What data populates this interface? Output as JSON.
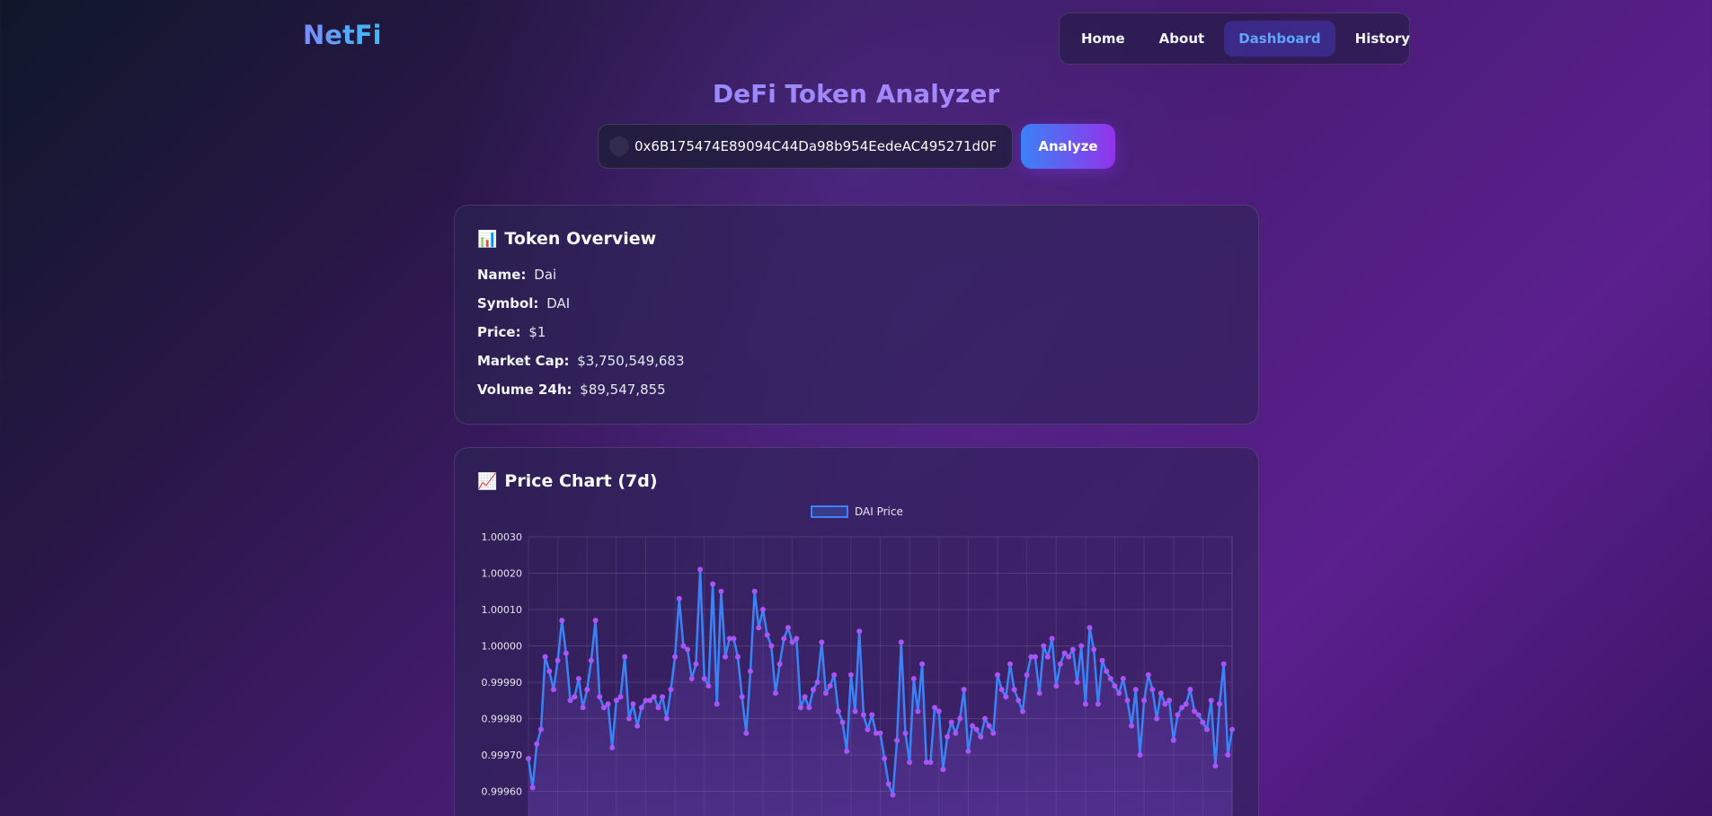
{
  "header": {
    "logo": "NetFi",
    "nav": [
      "Home",
      "About",
      "Dashboard",
      "History"
    ],
    "active_nav": "Dashboard"
  },
  "page_title": "DeFi Token Analyzer",
  "search": {
    "value": "0x6B175474E89094C44Da98b954EedeAC495271d0F",
    "button_label": "Analyze"
  },
  "overview": {
    "title": "Token Overview",
    "icon": "bar-chart-emoji",
    "rows": [
      {
        "label": "Name:",
        "value": "Dai"
      },
      {
        "label": "Symbol:",
        "value": "DAI"
      },
      {
        "label": "Price:",
        "value": "$1"
      },
      {
        "label": "Market Cap:",
        "value": "$3,750,549,683"
      },
      {
        "label": "Volume 24h:",
        "value": "$89,547,855"
      }
    ]
  },
  "chart_card": {
    "title": "Price Chart (7d)",
    "icon": "line-chart-emoji"
  },
  "chart_data": {
    "type": "line",
    "legend": "DAI Price",
    "legend_position": "top",
    "grid": true,
    "ylim": [
      0.99955,
      1.0003
    ],
    "yticks": [
      "1.00030",
      "1.00020",
      "1.00010",
      "1.00000",
      "0.99990",
      "0.99980",
      "0.99970",
      "0.99960"
    ],
    "colors": {
      "line": "#3b82f6",
      "point": "#a855f7"
    },
    "series": [
      {
        "name": "DAI Price",
        "values": [
          0.99969,
          0.99961,
          0.99973,
          0.99977,
          0.99997,
          0.99993,
          0.99988,
          0.99996,
          1.00007,
          0.99998,
          0.99985,
          0.99986,
          0.99991,
          0.99983,
          0.99988,
          0.99996,
          1.00007,
          0.99986,
          0.99983,
          0.99984,
          0.99972,
          0.99985,
          0.99986,
          0.99997,
          0.9998,
          0.99984,
          0.99978,
          0.99983,
          0.99985,
          0.99985,
          0.99986,
          0.99983,
          0.99986,
          0.9998,
          0.99988,
          0.99997,
          1.00013,
          1.0,
          0.99999,
          0.99991,
          0.99995,
          1.00021,
          0.99991,
          0.99989,
          1.00017,
          0.99984,
          1.00015,
          0.99997,
          1.00002,
          1.00002,
          0.99997,
          0.99986,
          0.99976,
          0.99993,
          1.00015,
          1.00005,
          1.0001,
          1.00003,
          1.0,
          0.99987,
          0.99995,
          1.00002,
          1.00005,
          1.00001,
          1.00002,
          0.99983,
          0.99986,
          0.99983,
          0.99988,
          0.9999,
          1.00001,
          0.99987,
          0.99989,
          0.99992,
          0.99982,
          0.99979,
          0.99971,
          0.99992,
          0.99982,
          1.00004,
          0.99981,
          0.99977,
          0.99981,
          0.99976,
          0.99976,
          0.99969,
          0.99962,
          0.99959,
          0.99974,
          1.00001,
          0.99976,
          0.99968,
          0.99991,
          0.99982,
          0.99995,
          0.99968,
          0.99968,
          0.99983,
          0.99982,
          0.99966,
          0.99975,
          0.99979,
          0.99976,
          0.9998,
          0.99988,
          0.99971,
          0.99978,
          0.99977,
          0.99975,
          0.9998,
          0.99978,
          0.99976,
          0.99992,
          0.99988,
          0.99986,
          0.99995,
          0.99988,
          0.99985,
          0.99982,
          0.99992,
          0.99997,
          0.99997,
          0.99987,
          1.0,
          0.99997,
          1.00002,
          0.99989,
          0.99995,
          0.99998,
          0.99997,
          0.99999,
          0.9999,
          1.0,
          0.99984,
          1.00005,
          0.99999,
          0.99984,
          0.99996,
          0.99993,
          0.99991,
          0.99989,
          0.99987,
          0.99991,
          0.99985,
          0.99978,
          0.99988,
          0.9997,
          0.99985,
          0.99992,
          0.99988,
          0.9998,
          0.99987,
          0.99984,
          0.99985,
          0.99974,
          0.99981,
          0.99983,
          0.99984,
          0.99988,
          0.99982,
          0.99981,
          0.99979,
          0.99977,
          0.99985,
          0.99967,
          0.99984,
          0.99995,
          0.9997,
          0.99977
        ]
      }
    ]
  }
}
